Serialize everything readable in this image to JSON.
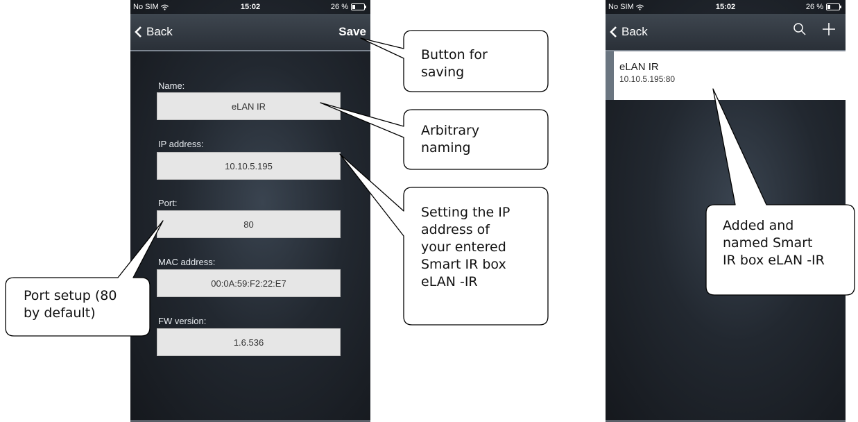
{
  "colors": {
    "accent": "#ffffff",
    "field_bg": "#e6e6e6",
    "marker": "#6a7580"
  },
  "left_screen": {
    "status": {
      "carrier": "No SIM",
      "time": "15:02",
      "battery": "26 %",
      "battery_level": 0.26
    },
    "nav": {
      "back_label": "Back",
      "save_label": "Save"
    },
    "fields": [
      {
        "label": "Name:",
        "value": "eLAN IR"
      },
      {
        "label": "IP address:",
        "value": "10.10.5.195"
      },
      {
        "label": "Port:",
        "value": "80"
      },
      {
        "label": "MAC address:",
        "value": "00:0A:59:F2:22:E7"
      },
      {
        "label": "FW version:",
        "value": "1.6.536"
      }
    ]
  },
  "right_screen": {
    "status": {
      "carrier": "No SIM",
      "time": "15:02",
      "battery": "26 %",
      "battery_level": 0.26
    },
    "nav": {
      "back_label": "Back",
      "icons": [
        "search-icon",
        "plus-icon"
      ]
    },
    "device": {
      "name": "eLAN IR",
      "address": "10.10.5.195:80"
    }
  },
  "callouts": {
    "save": [
      "Button for",
      "saving"
    ],
    "naming": [
      "Arbitrary",
      "naming"
    ],
    "ip": [
      "Setting the IP",
      "address of",
      "your entered",
      "Smart IR box",
      "eLAN -IR"
    ],
    "port": [
      "Port setup (80",
      "by default)"
    ],
    "added": [
      "Added and",
      "named Smart",
      "IR box eLAN -IR"
    ]
  }
}
